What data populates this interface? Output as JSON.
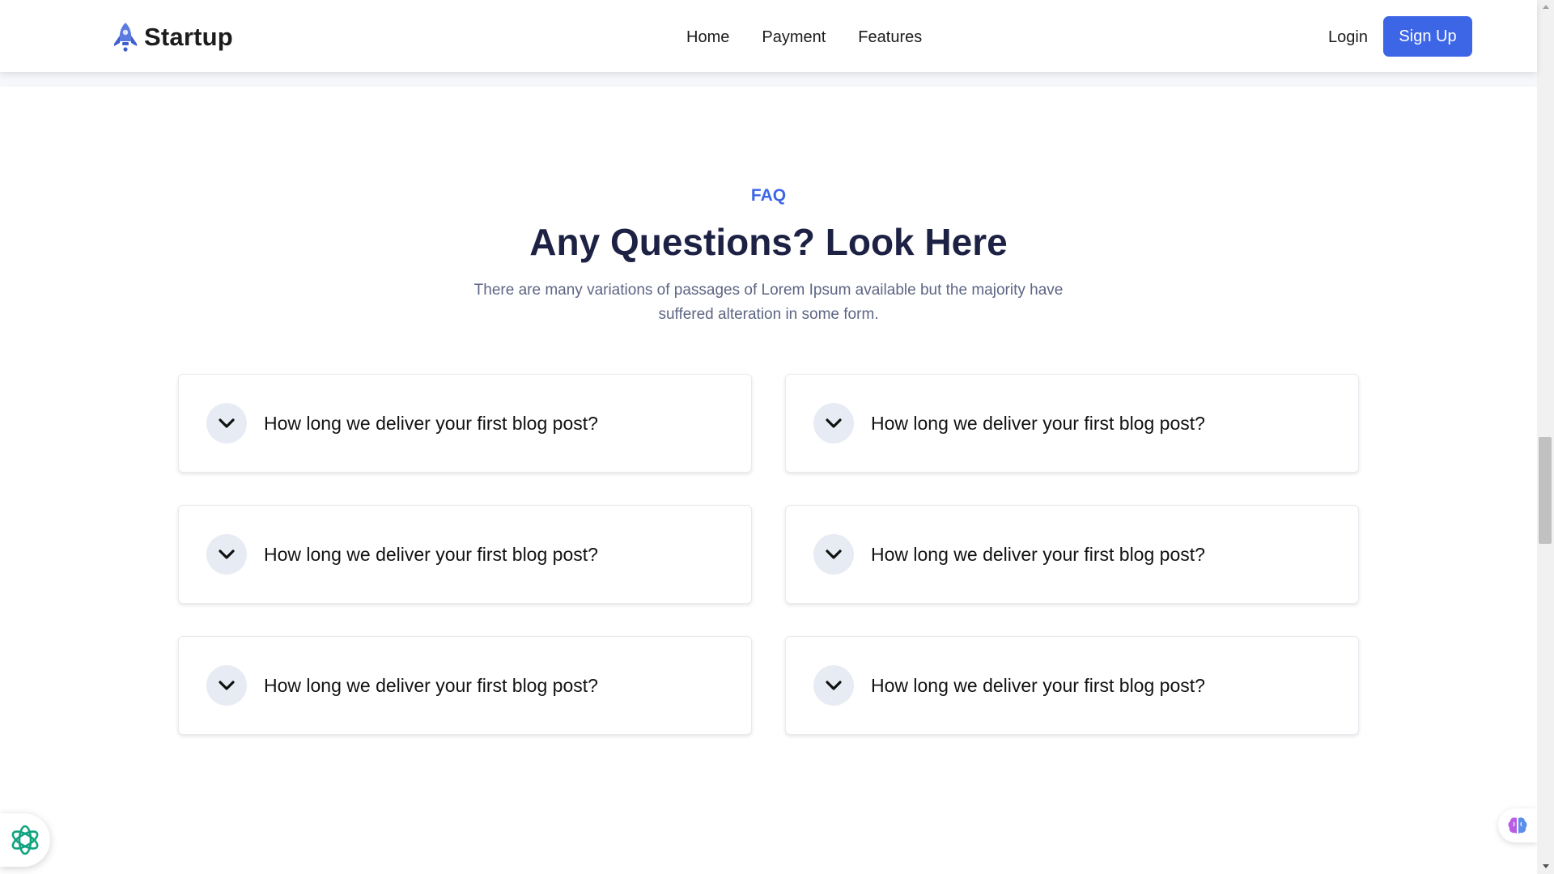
{
  "header": {
    "brand": "Startup",
    "nav": [
      {
        "label": "Home"
      },
      {
        "label": "Payment"
      },
      {
        "label": "Features"
      }
    ],
    "login_label": "Login",
    "signup_label": "Sign Up"
  },
  "faq": {
    "eyebrow": "FAQ",
    "title": "Any Questions? Look Here",
    "subtitle": "There are many variations of passages of Lorem Ipsum available but the majority have suffered alteration in some form.",
    "items": [
      {
        "question": "How long we deliver your first blog post?"
      },
      {
        "question": "How long we deliver your first blog post?"
      },
      {
        "question": "How long we deliver your first blog post?"
      },
      {
        "question": "How long we deliver your first blog post?"
      },
      {
        "question": "How long we deliver your first blog post?"
      },
      {
        "question": "How long we deliver your first blog post?"
      }
    ]
  },
  "colors": {
    "accent": "#3d66e6",
    "heading": "#1d2144",
    "body_text": "#5e6584",
    "chevron_bg": "#e7ebf3"
  },
  "icons": {
    "logo": "rocket-icon",
    "faq_toggle": "chevron-down-icon",
    "assistant_left": "openai-knot-icon",
    "assistant_right": "brain-icon"
  }
}
